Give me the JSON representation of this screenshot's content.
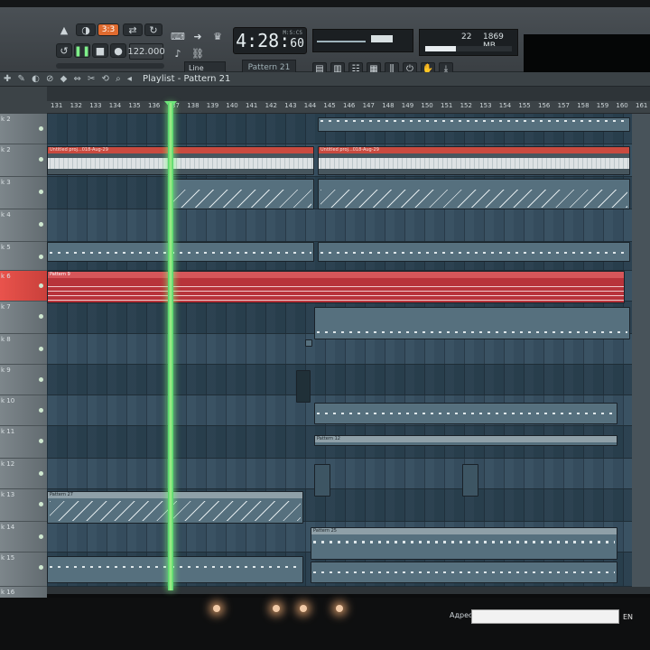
{
  "toolbar": {
    "pat_song_label": "3:3",
    "tempo": "122.000",
    "clock_main": "4:28:",
    "clock_frac": "60",
    "clock_tag": "M:S:CS",
    "snap_mode": "Line",
    "pattern_selector": "Pattern 21",
    "cpu_value": "22",
    "memory": "1869 MB",
    "cpu_fill_percent": 35
  },
  "playlist": {
    "title": "Playlist - Pattern 21",
    "ruler_ticks": [
      "131",
      "132",
      "133",
      "134",
      "135",
      "136",
      "137",
      "138",
      "139",
      "140",
      "141",
      "142",
      "143",
      "144",
      "145",
      "146",
      "147",
      "148",
      "149",
      "150",
      "151",
      "152",
      "153",
      "154",
      "155",
      "156",
      "157",
      "158",
      "159",
      "160",
      "161"
    ],
    "tracks": [
      {
        "label": "k 2"
      },
      {
        "label": "k 2"
      },
      {
        "label": "k 3"
      },
      {
        "label": "k 4"
      },
      {
        "label": "k 5"
      },
      {
        "label": "k 6"
      },
      {
        "label": "k 7"
      },
      {
        "label": "k 8"
      },
      {
        "label": "k 9"
      },
      {
        "label": "k 10"
      },
      {
        "label": "k 11"
      },
      {
        "label": "k 12"
      },
      {
        "label": "k 13"
      },
      {
        "label": "k 14"
      },
      {
        "label": "k 15"
      },
      {
        "label": "k 16"
      }
    ],
    "clips": {
      "audio_a": "Untitled proj...018-Aug-29",
      "audio_b": "Untitled proj...018-Aug-29",
      "pattern9": "Pattern 9",
      "pattern12": "Pattern 12",
      "pattern27": "Pattern 27",
      "pattern25": "Pattern 25"
    }
  },
  "taskbar": {
    "address_label": "Адрес",
    "lang": "EN"
  }
}
